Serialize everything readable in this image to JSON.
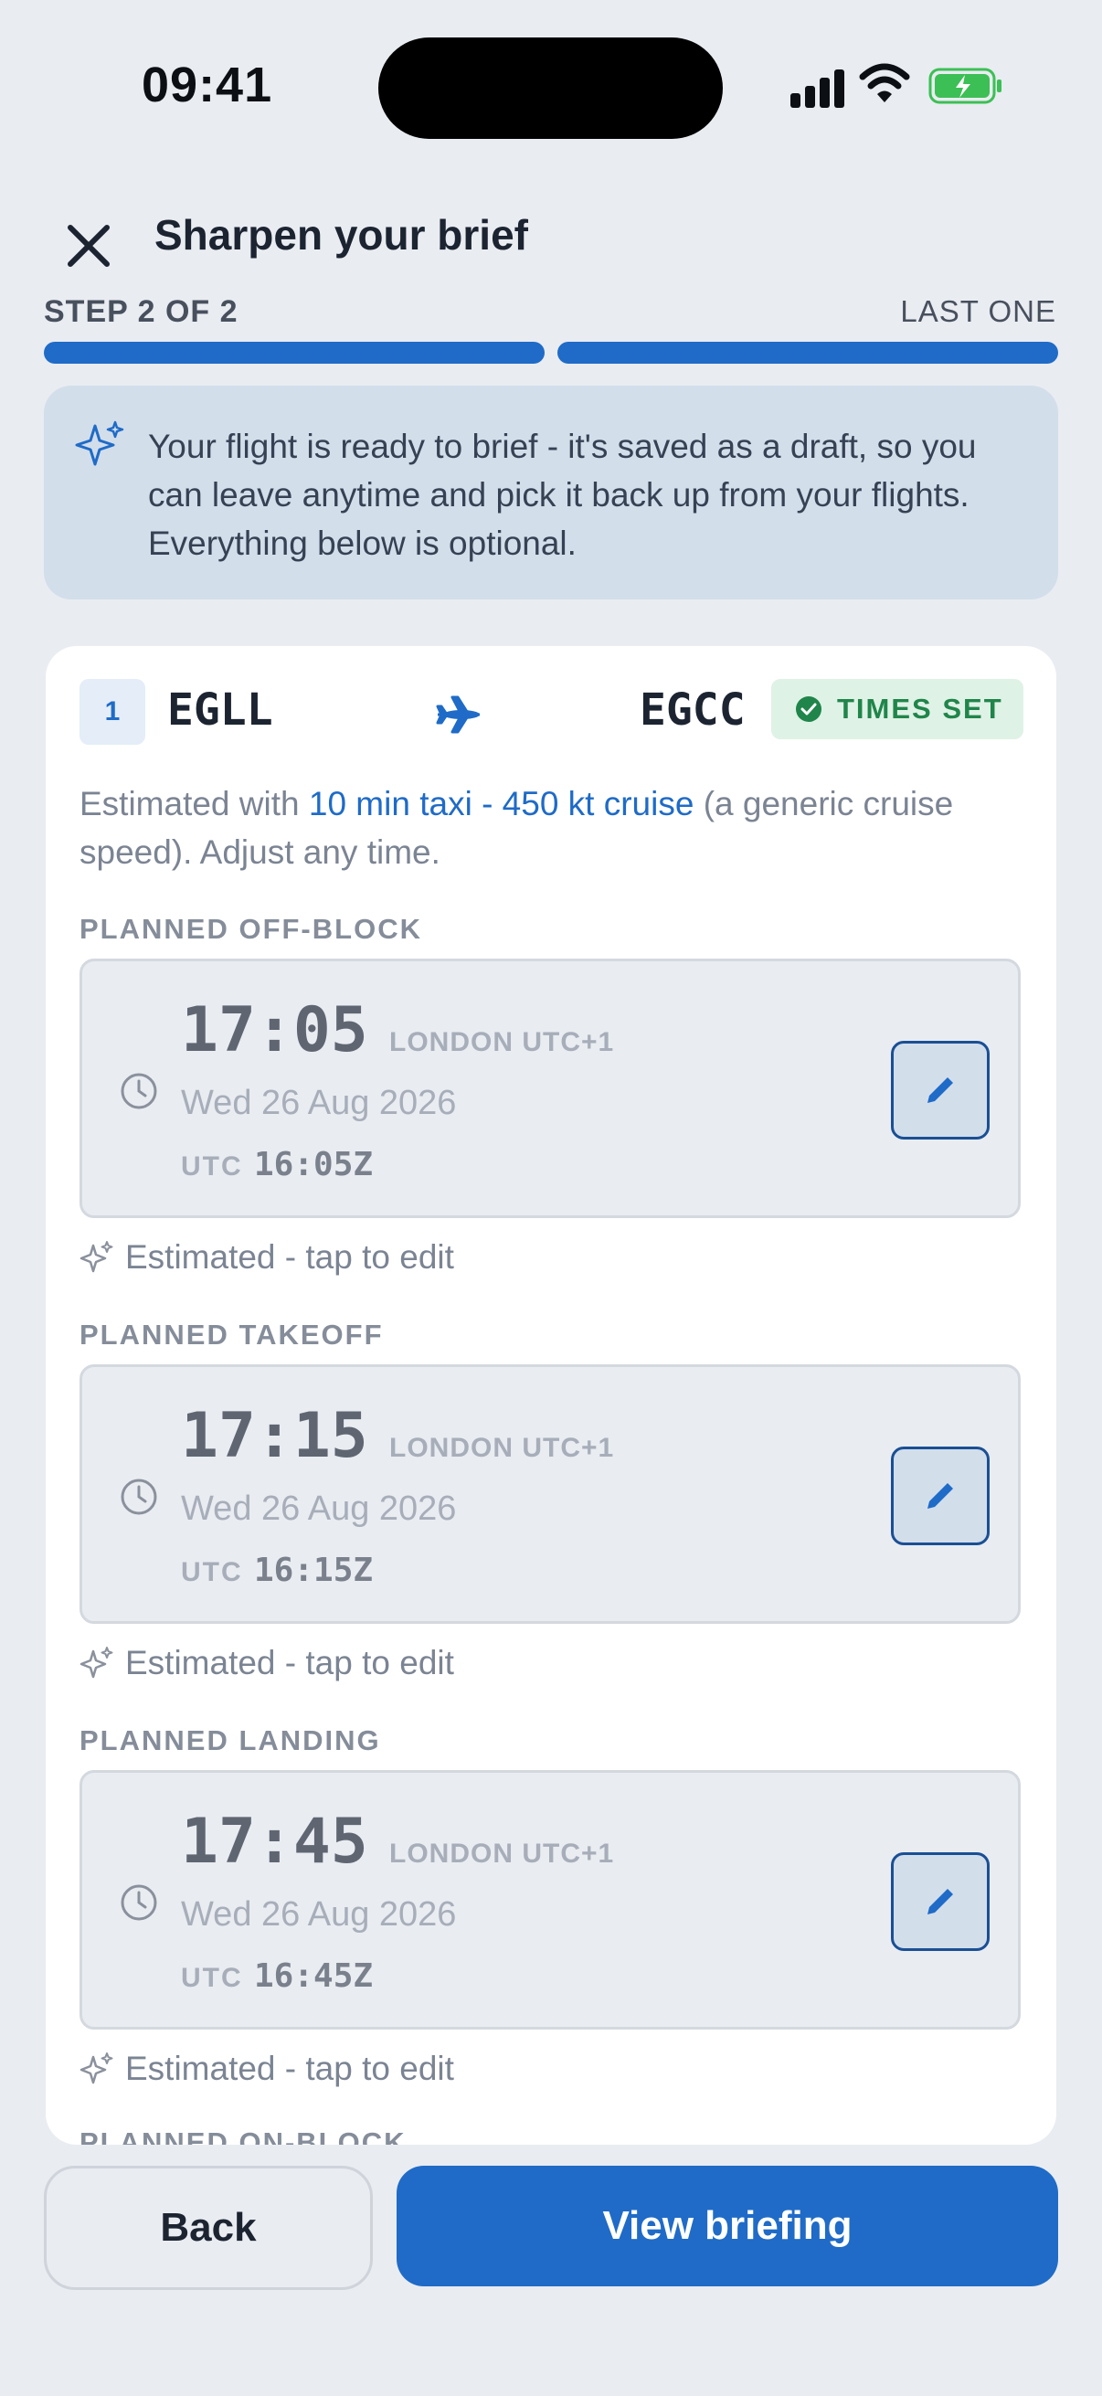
{
  "status_bar": {
    "time": "09:41"
  },
  "header": {
    "title": "Sharpen your brief"
  },
  "steps": {
    "label": "STEP 2 OF 2",
    "right_label": "LAST ONE",
    "current": 2,
    "total": 2
  },
  "banner": {
    "text": "Your flight is ready to brief - it's saved as a draft, so you can leave anytime and pick it back up from your flights. Everything below is optional."
  },
  "leg": {
    "number": "1",
    "from": "EGLL",
    "to": "EGCC",
    "badge": "TIMES SET",
    "estimate_prefix": "Estimated with ",
    "estimate_link": "10 min taxi - 450 kt cruise",
    "estimate_suffix": " (a generic cruise speed). Adjust any time."
  },
  "times": [
    {
      "label": "PLANNED OFF-BLOCK",
      "local": "17:05",
      "tz": "LONDON UTC+1",
      "date": "Wed 26 Aug 2026",
      "utc_label": "UTC",
      "utc": "16:05Z",
      "note": "Estimated - tap to edit"
    },
    {
      "label": "PLANNED TAKEOFF",
      "local": "17:15",
      "tz": "LONDON UTC+1",
      "date": "Wed 26 Aug 2026",
      "utc_label": "UTC",
      "utc": "16:15Z",
      "note": "Estimated - tap to edit"
    },
    {
      "label": "PLANNED LANDING",
      "local": "17:45",
      "tz": "LONDON UTC+1",
      "date": "Wed 26 Aug 2026",
      "utc_label": "UTC",
      "utc": "16:45Z",
      "note": "Estimated - tap to edit"
    }
  ],
  "next_section_label": "PLANNED ON-BLOCK",
  "footer": {
    "back_label": "Back",
    "view_label": "View briefing"
  },
  "colors": {
    "accent": "#1f6bc7",
    "success": "#20854a",
    "banner_bg": "#d3deeb"
  }
}
